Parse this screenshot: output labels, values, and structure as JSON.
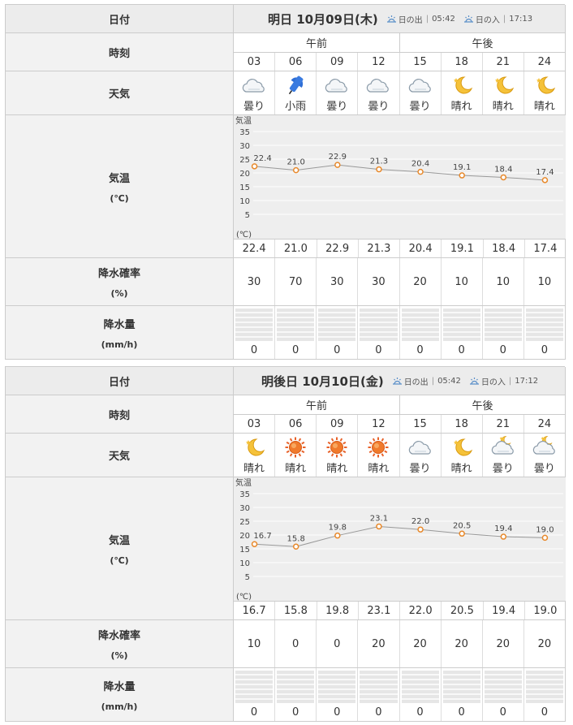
{
  "labels": {
    "date": "日付",
    "time": "時刻",
    "weather": "天気",
    "temp": "気温",
    "temp_unit": "(℃)",
    "prob": "降水確率",
    "prob_unit": "(%)",
    "amount": "降水量",
    "amount_unit": "(mm/h)",
    "am": "午前",
    "pm": "午後",
    "sunrise_label": "日の出",
    "sunset_label": "日の入",
    "axis_title": "気温",
    "axis_unit": "(℃)"
  },
  "hours": [
    "03",
    "06",
    "09",
    "12",
    "15",
    "18",
    "21",
    "24"
  ],
  "colors": {
    "line": "#999999",
    "marker": "#e8892b",
    "grid": "#ffffff",
    "chart_bg": "#eeeeee"
  },
  "days": [
    {
      "date": "明日 10月09日(木)",
      "sunrise": "05:42",
      "sunset": "17:13",
      "weather": [
        {
          "icon": "cloudy-icon",
          "text": "曇り"
        },
        {
          "icon": "umbrella-icon",
          "text": "小雨"
        },
        {
          "icon": "cloudy-icon",
          "text": "曇り"
        },
        {
          "icon": "cloudy-icon",
          "text": "曇り"
        },
        {
          "icon": "cloudy-icon",
          "text": "曇り"
        },
        {
          "icon": "moon-icon",
          "text": "晴れ"
        },
        {
          "icon": "moon-icon",
          "text": "晴れ"
        },
        {
          "icon": "moon-icon",
          "text": "晴れ"
        }
      ],
      "temps_text": [
        "22.4",
        "21.0",
        "22.9",
        "21.3",
        "20.4",
        "19.1",
        "18.4",
        "17.4"
      ],
      "prob": [
        "30",
        "70",
        "30",
        "30",
        "20",
        "10",
        "10",
        "10"
      ],
      "amount": [
        "0",
        "0",
        "0",
        "0",
        "0",
        "0",
        "0",
        "0"
      ]
    },
    {
      "date": "明後日 10月10日(金)",
      "sunrise": "05:42",
      "sunset": "17:12",
      "weather": [
        {
          "icon": "moon-icon",
          "text": "晴れ"
        },
        {
          "icon": "sun-icon",
          "text": "晴れ"
        },
        {
          "icon": "sun-icon",
          "text": "晴れ"
        },
        {
          "icon": "sun-icon",
          "text": "晴れ"
        },
        {
          "icon": "cloudy-icon",
          "text": "曇り"
        },
        {
          "icon": "moon-icon",
          "text": "晴れ"
        },
        {
          "icon": "cloudy-night-icon",
          "text": "曇り"
        },
        {
          "icon": "cloudy-night-icon",
          "text": "曇り"
        }
      ],
      "temps_text": [
        "16.7",
        "15.8",
        "19.8",
        "23.1",
        "22.0",
        "20.5",
        "19.4",
        "19.0"
      ],
      "prob": [
        "10",
        "0",
        "0",
        "20",
        "20",
        "20",
        "20",
        "20"
      ],
      "amount": [
        "0",
        "0",
        "0",
        "0",
        "0",
        "0",
        "0",
        "0"
      ]
    }
  ],
  "chart_data": [
    {
      "type": "line",
      "title": "",
      "ylabel": "気温",
      "yunit": "(℃)",
      "ylim": [
        0,
        35
      ],
      "yticks": [
        5,
        10,
        15,
        20,
        25,
        30,
        35
      ],
      "grid": true,
      "categories": [
        "03",
        "06",
        "09",
        "12",
        "15",
        "18",
        "21",
        "24"
      ],
      "values": [
        22.4,
        21.0,
        22.9,
        21.3,
        20.4,
        19.1,
        18.4,
        17.4
      ]
    },
    {
      "type": "line",
      "title": "",
      "ylabel": "気温",
      "yunit": "(℃)",
      "ylim": [
        0,
        35
      ],
      "yticks": [
        5,
        10,
        15,
        20,
        25,
        30,
        35
      ],
      "grid": true,
      "categories": [
        "03",
        "06",
        "09",
        "12",
        "15",
        "18",
        "21",
        "24"
      ],
      "values": [
        16.7,
        15.8,
        19.8,
        23.1,
        22.0,
        20.5,
        19.4,
        19.0
      ]
    }
  ]
}
